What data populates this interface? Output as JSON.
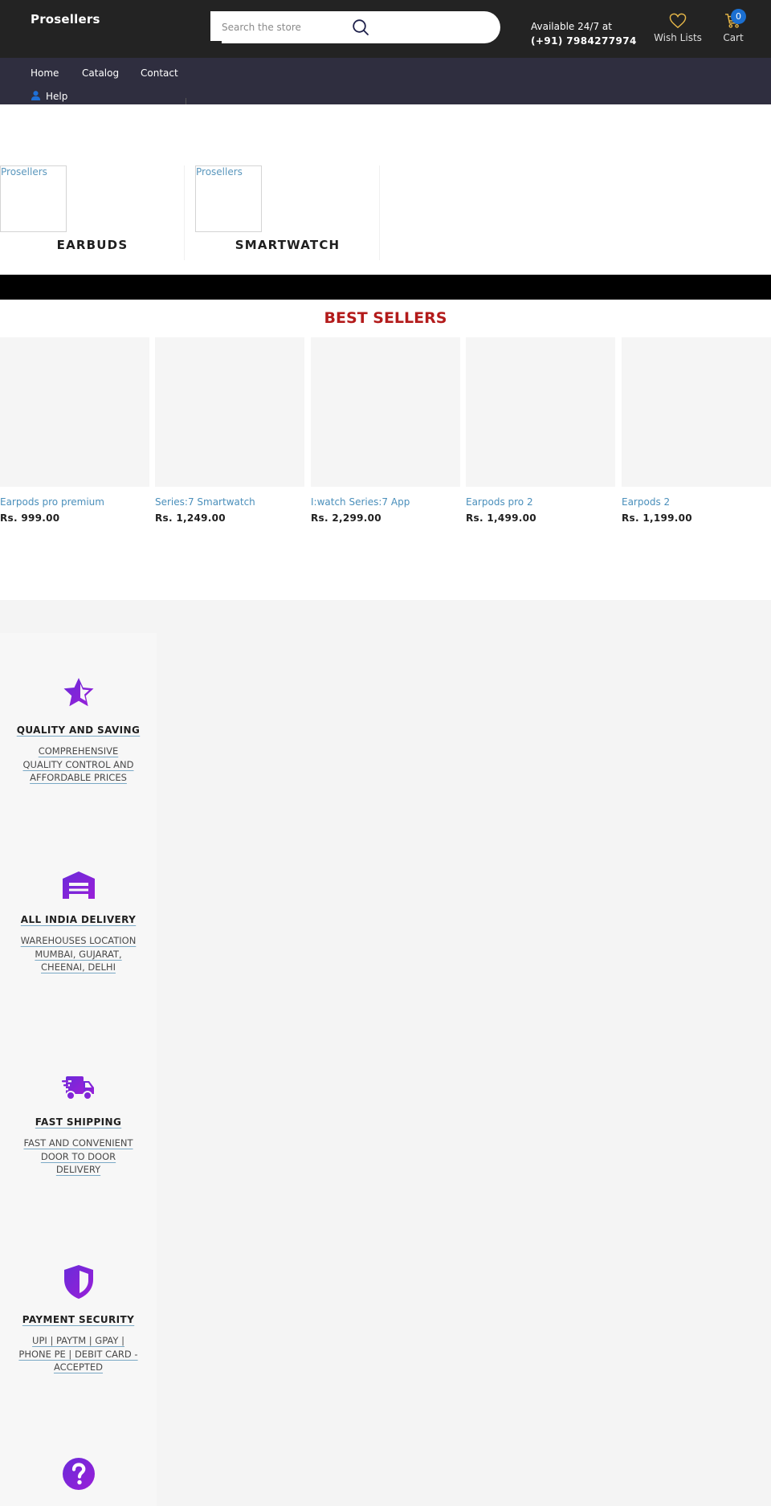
{
  "header": {
    "logo": "Prosellers",
    "search_placeholder": "Search the store",
    "availability_label": "Available 24/7 at",
    "phone": "(+91) 7984277974",
    "wishlist_label": "Wish Lists",
    "cart_label": "Cart",
    "cart_count": "0",
    "icon_accent": "#e5b648",
    "badge_color": "#1b6fd1"
  },
  "nav": {
    "items": [
      {
        "label": "Home"
      },
      {
        "label": "Catalog"
      },
      {
        "label": "Contact"
      }
    ],
    "help_label": "Help"
  },
  "categories": [
    {
      "image_alt": "Prosellers",
      "title": "EARBUDS"
    },
    {
      "image_alt": "Prosellers",
      "title": "SMARTWATCH"
    }
  ],
  "best_sellers": {
    "title": "BEST SELLERS",
    "title_color": "#b31b1b",
    "products": [
      {
        "name": "Earpods pro premium",
        "price": "Rs. 999.00"
      },
      {
        "name": "Series:7 Smartwatch",
        "price": "Rs. 1,249.00"
      },
      {
        "name": "I:watch Series:7 App",
        "price": "Rs. 2,299.00"
      },
      {
        "name": "Earpods pro 2",
        "price": "Rs. 1,499.00"
      },
      {
        "name": "Earpods 2",
        "price": "Rs. 1,199.00"
      }
    ]
  },
  "features": {
    "icon_color": "#7b22d6",
    "items": [
      {
        "icon": "star-half-icon",
        "title": "QUALITY AND SAVING",
        "description": "COMPREHENSIVE QUALITY CONTROL AND AFFORDABLE PRICES"
      },
      {
        "icon": "warehouse-icon",
        "title": "ALL INDIA DELIVERY",
        "description": "WAREHOUSES LOCATION MUMBAI, GUJARAT, CHEENAI, DELHI"
      },
      {
        "icon": "truck-fast-icon",
        "title": "FAST SHIPPING",
        "description": "FAST AND CONVENIENT DOOR TO DOOR DELIVERY"
      },
      {
        "icon": "shield-icon",
        "title": "PAYMENT SECURITY",
        "description": "UPI | PAYTM | GPAY | PHONE PE | DEBIT CARD - ACCEPTED"
      },
      {
        "icon": "question-circle-icon"
      }
    ]
  }
}
